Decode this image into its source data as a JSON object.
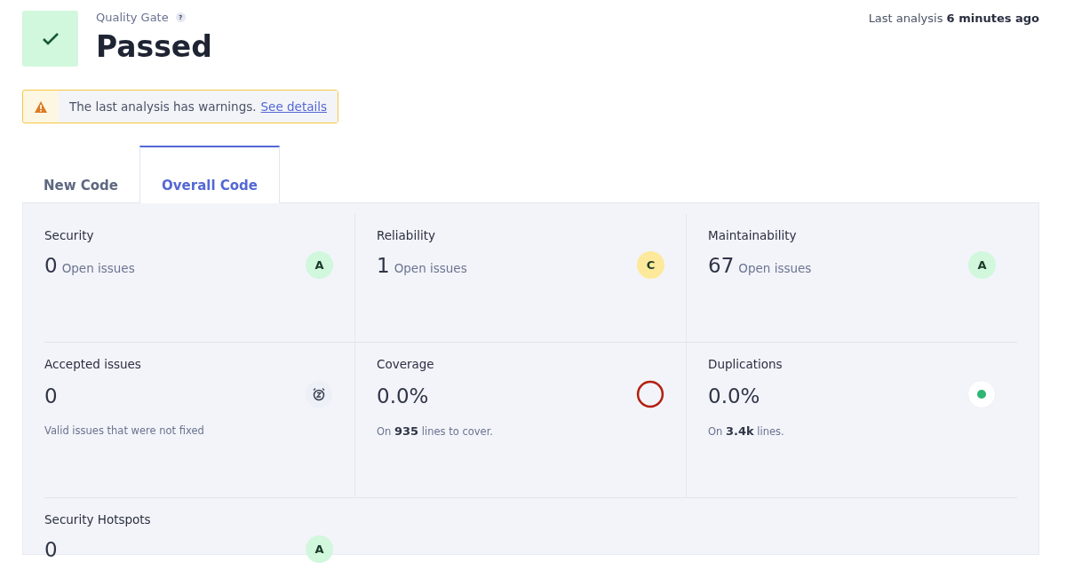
{
  "quality_gate": {
    "label": "Quality Gate",
    "help": "?",
    "status": "Passed",
    "passed": true
  },
  "last_analysis": "Last analysis **6 minutes ago**",
  "warning": {
    "text": "The last analysis has warnings.",
    "link": "See details"
  },
  "tabs": [
    {
      "label": "New Code",
      "selected": false
    },
    {
      "label": "Overall Code",
      "selected": true
    }
  ],
  "metrics": [
    {
      "kind": "rating",
      "label": "Security",
      "value": "0",
      "suffix": "Open issues",
      "rating": "A",
      "color": "#d1f7dd"
    },
    {
      "kind": "rating",
      "label": "Reliability",
      "value": "1",
      "suffix": "Open issues",
      "rating": "C",
      "color": "#fce99b"
    },
    {
      "kind": "rating",
      "label": "Maintainability",
      "value": "67",
      "suffix": "Open issues",
      "rating": "A",
      "color": "#d1f7dd"
    },
    {
      "kind": "accepted",
      "label": "Accepted issues",
      "value": "0",
      "note": "Valid issues that were not fixed"
    },
    {
      "kind": "coverage",
      "label": "Coverage",
      "value": "0.0%",
      "note": "On **935** lines to cover."
    },
    {
      "kind": "duplication",
      "label": "Duplications",
      "value": "0.0%",
      "note": "On **3.4k** lines."
    },
    {
      "kind": "rating",
      "label": "Security Hotspots",
      "value": "0",
      "rating": "A",
      "color": "#d1f7dd"
    }
  ]
}
